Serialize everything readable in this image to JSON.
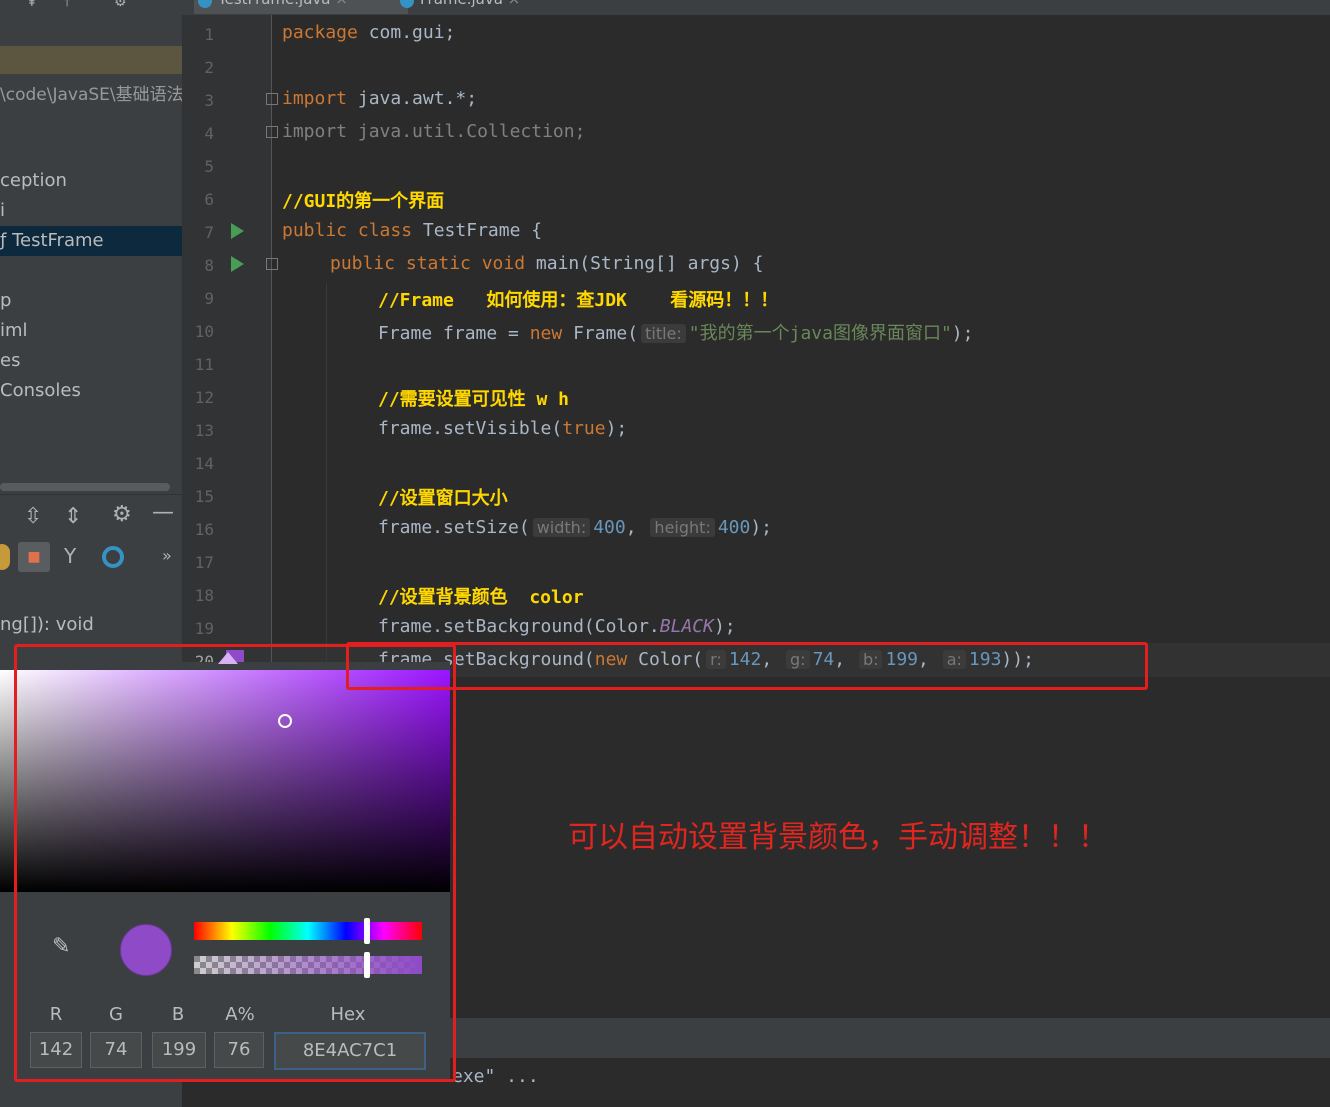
{
  "tabs": [
    {
      "label": "TestFrame.java"
    },
    {
      "label": "Frame.java"
    }
  ],
  "project": {
    "path": "\\code\\JavaSE\\基础语法",
    "items": [
      "ception",
      "i",
      "TestFrame",
      "p",
      "iml",
      "es",
      "Consoles"
    ],
    "method_sig": "ng[]): void"
  },
  "editor": {
    "line_numbers": [
      "1",
      "2",
      "3",
      "4",
      "5",
      "6",
      "7",
      "8",
      "9",
      "10",
      "11",
      "12",
      "13",
      "14",
      "15",
      "16",
      "17",
      "18",
      "19",
      "20"
    ],
    "lines": {
      "l1_kw": "package",
      "l1_rest": " com.gui;",
      "l3_kw": "import",
      "l3_rest": " java.awt.*;",
      "l4_text": "import java.util.Collection;",
      "l6_comment": "//GUI的第一个界面",
      "l7_kw": "public class",
      "l7_rest": " TestFrame {",
      "l8_kw": "public static void",
      "l8_rest": " main(String[] args) {",
      "l9_comment": "//Frame   如何使用：查JDK    看源码！！！",
      "l10_a": "Frame frame = ",
      "l10_new": "new",
      "l10_b": " Frame(",
      "l10_hint": "title:",
      "l10_str": "\"我的第一个java图像界面窗口\"",
      "l10_end": ");",
      "l12_comment": "//需要设置可见性 w h",
      "l13_a": "frame.setVisible(",
      "l13_kw": "true",
      "l13_end": ");",
      "l15_comment": "//设置窗口大小",
      "l16_a": "frame.setSize(",
      "l16_hint1": "width:",
      "l16_num1": "400",
      "l16_hint2": "height:",
      "l16_num2": "400",
      "l16_end": ");",
      "l18_comment": "//设置背景颜色  color",
      "l19_a": "frame.setBackground(Color.",
      "l19_field": "BLACK",
      "l19_end": ");",
      "l20_a": "frame.setBackground(",
      "l20_new": "new",
      "l20_b": " Color(",
      "l20_hint_r": "r:",
      "l20_r": "142",
      "l20_hint_g": "g:",
      "l20_g": "74",
      "l20_hint_b": "b:",
      "l20_bv": "199",
      "l20_hint_a": "a:",
      "l20_a_val": "193",
      "l20_end": "));"
    }
  },
  "picker": {
    "labels": {
      "r": "R",
      "g": "G",
      "b": "B",
      "a": "A%",
      "hex": "Hex"
    },
    "values": {
      "r": "142",
      "g": "74",
      "b": "199",
      "a": "76",
      "hex": "8E4AC7C1"
    },
    "preview_color": "#8e4ac7",
    "hue_position_fraction": 0.76,
    "alpha_position_fraction": 0.76
  },
  "annotation": "可以自动设置背景颜色，手动调整！！！",
  "console_fragment": "exe\" ...",
  "colors": {
    "annotation_red": "#e21e1e",
    "keyword": "#cc7832",
    "comment": "#ffd800",
    "number": "#6897bb",
    "string": "#6a8759"
  }
}
